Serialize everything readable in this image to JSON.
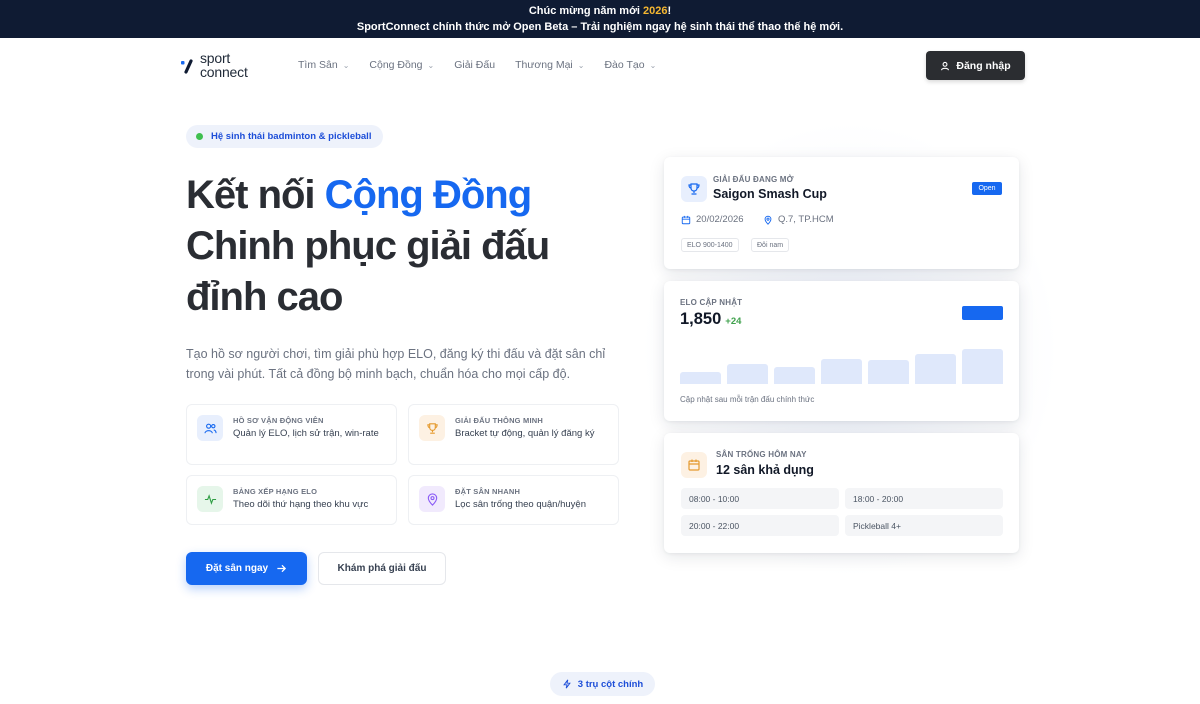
{
  "announcement": {
    "line1_prefix": "Chúc mừng năm mới ",
    "line1_year": "2026",
    "line1_suffix": "!",
    "line2": "SportConnect chính thức mở Open Beta – Trải nghiệm ngay hệ sinh thái thể thao thế hệ mới."
  },
  "nav": {
    "logo_top": "sport",
    "logo_bottom": "connect",
    "menu": [
      {
        "label": "Tìm Sân",
        "has_dropdown": true
      },
      {
        "label": "Cộng Đồng",
        "has_dropdown": true
      },
      {
        "label": "Giải Đấu",
        "has_dropdown": false
      },
      {
        "label": "Thương Mại",
        "has_dropdown": true
      },
      {
        "label": "Đào Tạo",
        "has_dropdown": true
      }
    ],
    "chevron": "⌄",
    "login_label": "Đăng nhập",
    "login_icon": "user-icon"
  },
  "hero": {
    "pill_label": "Hệ sinh thái badminton & pickleball",
    "title_line1_prefix": "Kết nối ",
    "title_line1_accent": "Cộng Đồng",
    "title_line2": "Chinh phục giải đấu",
    "title_line3": "đỉnh cao",
    "description": "Tạo hồ sơ người chơi, tìm giải phù hợp ELO, đăng ký thi đấu và đặt sân chỉ trong vài phút. Tất cả đồng bộ minh bạch, chuẩn hóa cho mọi cấp độ.",
    "features": [
      {
        "title": "HỒ SƠ VẬN ĐỘNG VIÊN",
        "desc": "Quản lý ELO, lịch sử trận, win-rate",
        "icon": "users-icon"
      },
      {
        "title": "GIẢI ĐẤU THÔNG MINH",
        "desc": "Bracket tự động, quản lý đăng ký",
        "icon": "trophy-icon"
      },
      {
        "title": "BẢNG XẾP HẠNG ELO",
        "desc": "Theo dõi thứ hạng theo khu vực",
        "icon": "activity-icon"
      },
      {
        "title": "ĐẶT SÂN NHANH",
        "desc": "Lọc sân trống theo quận/huyện",
        "icon": "map-pin-icon"
      }
    ],
    "primary_cta": "Đặt sân ngay",
    "secondary_cta": "Khám phá giải đấu"
  },
  "tournament_card": {
    "label": "GIẢI ĐẤU ĐANG MỞ",
    "name": "Saigon Smash Cup",
    "status": "Open",
    "date": "20/02/2026",
    "location": "Q.7, TP.HCM",
    "tags": [
      "ELO 900-1400",
      "Đôi nam"
    ]
  },
  "elo_card": {
    "label": "ELO CẬP NHẬT",
    "value": "1,850",
    "delta": "+24",
    "bars": [
      0.3,
      0.48,
      0.42,
      0.62,
      0.58,
      0.74,
      0.85
    ],
    "note": "Cập nhật sau mỗi trận đấu chính thức"
  },
  "courts_card": {
    "label": "SÂN TRỐNG HÔM NAY",
    "title": "12 sân khả dụng",
    "slots": [
      "08:00 - 10:00",
      "18:00 - 20:00",
      "20:00 - 22:00",
      "Pickleball 4+"
    ]
  },
  "section_pill": "3 trụ cột chính",
  "colors": {
    "accent": "#1668f0",
    "dark": "#0f1b33",
    "year": "#f5b731",
    "positive": "#3fa14c"
  }
}
